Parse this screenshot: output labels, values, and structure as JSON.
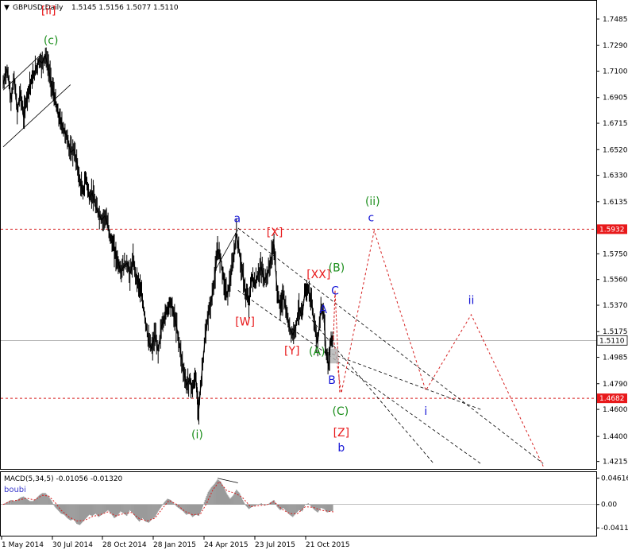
{
  "header": {
    "symbol_label": "GBPUSD,Daily",
    "ohlc": "1.5145 1.5156 1.5077 1.5110"
  },
  "colors": {
    "price": "#000000",
    "red": "#e8191b",
    "blue": "#1717d6",
    "green": "#1d8f1d",
    "dashed_red": "#d62020",
    "current_price_bg": "#ffffff",
    "level_bg": "#e8191b",
    "grid_line": "#888888"
  },
  "chart_data": [
    {
      "type": "line",
      "title": "GBPUSD,Daily",
      "subtitle": "1.5145 1.5156 1.5077 1.5110",
      "x_ticks": [
        "1 May 2014",
        "30 Jul 2014",
        "28 Oct 2014",
        "28 Jan 2015",
        "24 Apr 2015",
        "23 Jul 2015",
        "21 Oct 2015"
      ],
      "y_ticks": [
        "1.7485",
        "1.7290",
        "1.7100",
        "1.6905",
        "1.6715",
        "1.6520",
        "1.6330",
        "1.6135",
        "1.5945",
        "1.5750",
        "1.5560",
        "1.5370",
        "1.5175",
        "1.4985",
        "1.4790",
        "1.4600",
        "1.4400",
        "1.4215"
      ],
      "ylim": [
        1.416,
        1.762
      ],
      "current_price": "1.5110",
      "levels": [
        {
          "label": "1.5932",
          "value": 1.5932
        },
        {
          "label": "1.4682",
          "value": 1.4682
        }
      ],
      "price_series": [
        [
          0,
          1.7
        ],
        [
          5,
          1.712
        ],
        [
          10,
          1.689
        ],
        [
          14,
          1.705
        ],
        [
          18,
          1.68
        ],
        [
          22,
          1.695
        ],
        [
          26,
          1.676
        ],
        [
          30,
          1.69
        ],
        [
          34,
          1.7
        ],
        [
          38,
          1.705
        ],
        [
          42,
          1.712
        ],
        [
          46,
          1.718
        ],
        [
          50,
          1.716
        ],
        [
          54,
          1.722
        ],
        [
          58,
          1.712
        ],
        [
          62,
          1.7
        ],
        [
          66,
          1.69
        ],
        [
          70,
          1.678
        ],
        [
          74,
          1.672
        ],
        [
          78,
          1.666
        ],
        [
          82,
          1.66
        ],
        [
          86,
          1.65
        ],
        [
          90,
          1.652
        ],
        [
          94,
          1.643
        ],
        [
          98,
          1.628
        ],
        [
          102,
          1.62
        ],
        [
          106,
          1.632
        ],
        [
          110,
          1.616
        ],
        [
          114,
          1.62
        ],
        [
          118,
          1.61
        ],
        [
          122,
          1.605
        ],
        [
          126,
          1.6
        ],
        [
          130,
          1.603
        ],
        [
          134,
          1.596
        ],
        [
          138,
          1.585
        ],
        [
          142,
          1.578
        ],
        [
          146,
          1.57
        ],
        [
          150,
          1.562
        ],
        [
          154,
          1.566
        ],
        [
          158,
          1.568
        ],
        [
          162,
          1.56
        ],
        [
          166,
          1.57
        ],
        [
          170,
          1.558
        ],
        [
          174,
          1.552
        ],
        [
          178,
          1.54
        ],
        [
          182,
          1.525
        ],
        [
          186,
          1.51
        ],
        [
          190,
          1.505
        ],
        [
          194,
          1.515
        ],
        [
          198,
          1.503
        ],
        [
          202,
          1.52
        ],
        [
          206,
          1.528
        ],
        [
          210,
          1.535
        ],
        [
          214,
          1.54
        ],
        [
          218,
          1.53
        ],
        [
          222,
          1.52
        ],
        [
          226,
          1.505
        ],
        [
          230,
          1.49
        ],
        [
          234,
          1.478
        ],
        [
          238,
          1.482
        ],
        [
          242,
          1.475
        ],
        [
          246,
          1.485
        ],
        [
          248,
          1.468
        ],
        [
          250,
          1.46
        ],
        [
          254,
          1.488
        ],
        [
          258,
          1.512
        ],
        [
          262,
          1.53
        ],
        [
          266,
          1.54
        ],
        [
          270,
          1.556
        ],
        [
          274,
          1.578
        ],
        [
          278,
          1.572
        ],
        [
          282,
          1.555
        ],
        [
          286,
          1.545
        ],
        [
          290,
          1.555
        ],
        [
          294,
          1.57
        ],
        [
          298,
          1.59
        ],
        [
          302,
          1.575
        ],
        [
          306,
          1.56
        ],
        [
          310,
          1.545
        ],
        [
          314,
          1.54
        ],
        [
          318,
          1.558
        ],
        [
          322,
          1.552
        ],
        [
          326,
          1.56
        ],
        [
          330,
          1.565
        ],
        [
          334,
          1.555
        ],
        [
          338,
          1.56
        ],
        [
          342,
          1.57
        ],
        [
          346,
          1.582
        ],
        [
          350,
          1.548
        ],
        [
          354,
          1.535
        ],
        [
          358,
          1.545
        ],
        [
          362,
          1.53
        ],
        [
          366,
          1.52
        ],
        [
          370,
          1.515
        ],
        [
          374,
          1.522
        ],
        [
          378,
          1.535
        ],
        [
          382,
          1.528
        ],
        [
          386,
          1.55
        ],
        [
          390,
          1.548
        ],
        [
          394,
          1.54
        ],
        [
          398,
          1.52
        ],
        [
          402,
          1.51
        ],
        [
          406,
          1.535
        ],
        [
          410,
          1.53
        ],
        [
          412,
          1.505
        ],
        [
          416,
          1.492
        ],
        [
          418,
          1.51
        ],
        [
          422,
          1.511
        ]
      ],
      "macd_panel": {
        "title": "MACD(5,34,5) -0.01056 -0.01320",
        "subtitle": "boubi",
        "y_ticks": [
          "0.04616",
          "0.00",
          "-0.04114"
        ],
        "ylim": [
          -0.052,
          0.054
        ],
        "histogram": [
          [
            0,
            0.0
          ],
          [
            5,
            0.004
          ],
          [
            10,
            0.008
          ],
          [
            14,
            0.006
          ],
          [
            18,
            0.008
          ],
          [
            22,
            0.012
          ],
          [
            26,
            0.014
          ],
          [
            30,
            0.01
          ],
          [
            34,
            0.006
          ],
          [
            38,
            0.006
          ],
          [
            42,
            0.01
          ],
          [
            46,
            0.016
          ],
          [
            50,
            0.02
          ],
          [
            54,
            0.02
          ],
          [
            58,
            0.014
          ],
          [
            62,
            0.006
          ],
          [
            66,
            -0.004
          ],
          [
            70,
            -0.01
          ],
          [
            74,
            -0.016
          ],
          [
            78,
            -0.018
          ],
          [
            82,
            -0.024
          ],
          [
            86,
            -0.028
          ],
          [
            90,
            -0.026
          ],
          [
            94,
            -0.034
          ],
          [
            98,
            -0.036
          ],
          [
            102,
            -0.03
          ],
          [
            106,
            -0.024
          ],
          [
            110,
            -0.018
          ],
          [
            114,
            -0.02
          ],
          [
            118,
            -0.016
          ],
          [
            122,
            -0.022
          ],
          [
            126,
            -0.018
          ],
          [
            130,
            -0.014
          ],
          [
            134,
            -0.01
          ],
          [
            138,
            -0.016
          ],
          [
            142,
            -0.024
          ],
          [
            146,
            -0.02
          ],
          [
            150,
            -0.012
          ],
          [
            154,
            -0.016
          ],
          [
            158,
            -0.02
          ],
          [
            162,
            -0.01
          ],
          [
            166,
            -0.016
          ],
          [
            170,
            -0.024
          ],
          [
            174,
            -0.03
          ],
          [
            178,
            -0.024
          ],
          [
            182,
            -0.03
          ],
          [
            186,
            -0.032
          ],
          [
            190,
            -0.026
          ],
          [
            194,
            -0.022
          ],
          [
            198,
            -0.012
          ],
          [
            202,
            -0.004
          ],
          [
            206,
            0.004
          ],
          [
            210,
            0.01
          ],
          [
            214,
            0.008
          ],
          [
            218,
            0.002
          ],
          [
            222,
            -0.004
          ],
          [
            226,
            -0.008
          ],
          [
            230,
            -0.012
          ],
          [
            234,
            -0.018
          ],
          [
            238,
            -0.016
          ],
          [
            242,
            -0.022
          ],
          [
            246,
            -0.018
          ],
          [
            250,
            -0.02
          ],
          [
            254,
            -0.008
          ],
          [
            258,
            0.008
          ],
          [
            262,
            0.022
          ],
          [
            266,
            0.03
          ],
          [
            270,
            0.036
          ],
          [
            274,
            0.044
          ],
          [
            278,
            0.04
          ],
          [
            282,
            0.03
          ],
          [
            286,
            0.018
          ],
          [
            290,
            0.01
          ],
          [
            294,
            0.016
          ],
          [
            298,
            0.026
          ],
          [
            302,
            0.02
          ],
          [
            306,
            0.008
          ],
          [
            310,
            -0.002
          ],
          [
            314,
            -0.008
          ],
          [
            318,
            -0.004
          ],
          [
            322,
            -0.002
          ],
          [
            326,
            0.0
          ],
          [
            330,
            0.002
          ],
          [
            334,
            -0.002
          ],
          [
            338,
            0.0
          ],
          [
            342,
            0.004
          ],
          [
            346,
            0.008
          ],
          [
            350,
            -0.004
          ],
          [
            354,
            -0.01
          ],
          [
            358,
            -0.006
          ],
          [
            362,
            -0.012
          ],
          [
            366,
            -0.018
          ],
          [
            370,
            -0.022
          ],
          [
            374,
            -0.016
          ],
          [
            378,
            -0.01
          ],
          [
            382,
            -0.012
          ],
          [
            386,
            0.0
          ],
          [
            390,
            0.002
          ],
          [
            394,
            -0.004
          ],
          [
            398,
            -0.01
          ],
          [
            402,
            -0.014
          ],
          [
            406,
            -0.006
          ],
          [
            410,
            -0.008
          ],
          [
            414,
            -0.014
          ],
          [
            418,
            -0.012
          ],
          [
            422,
            -0.011
          ]
        ],
        "signal": [
          [
            0,
            0.0
          ],
          [
            10,
            0.006
          ],
          [
            20,
            0.008
          ],
          [
            30,
            0.011
          ],
          [
            40,
            0.008
          ],
          [
            50,
            0.016
          ],
          [
            58,
            0.015
          ],
          [
            66,
            0.004
          ],
          [
            74,
            -0.01
          ],
          [
            84,
            -0.022
          ],
          [
            94,
            -0.029
          ],
          [
            104,
            -0.028
          ],
          [
            114,
            -0.021
          ],
          [
            124,
            -0.018
          ],
          [
            134,
            -0.013
          ],
          [
            144,
            -0.02
          ],
          [
            154,
            -0.016
          ],
          [
            164,
            -0.014
          ],
          [
            174,
            -0.025
          ],
          [
            184,
            -0.029
          ],
          [
            194,
            -0.024
          ],
          [
            204,
            -0.006
          ],
          [
            212,
            0.007
          ],
          [
            222,
            0.0
          ],
          [
            232,
            -0.012
          ],
          [
            242,
            -0.018
          ],
          [
            252,
            -0.017
          ],
          [
            260,
            0.002
          ],
          [
            268,
            0.026
          ],
          [
            276,
            0.04
          ],
          [
            286,
            0.024
          ],
          [
            296,
            0.02
          ],
          [
            306,
            0.012
          ],
          [
            316,
            -0.004
          ],
          [
            326,
            -0.002
          ],
          [
            338,
            0.0
          ],
          [
            346,
            0.005
          ],
          [
            356,
            -0.008
          ],
          [
            366,
            -0.016
          ],
          [
            376,
            -0.016
          ],
          [
            386,
            -0.004
          ],
          [
            396,
            -0.005
          ],
          [
            406,
            -0.01
          ],
          [
            416,
            -0.012
          ],
          [
            422,
            -0.013
          ]
        ]
      }
    }
  ],
  "wave_labels": [
    {
      "text": "[ii]",
      "color": "red",
      "xi": 58,
      "y": 1.752
    },
    {
      "text": "(c)",
      "color": "green",
      "xi": 61,
      "y": 1.73
    },
    {
      "text": "a",
      "color": "blue",
      "xi": 299,
      "y": 1.5985
    },
    {
      "text": "(ii)",
      "color": "green",
      "xi": 472,
      "y": 1.611
    },
    {
      "text": "c",
      "color": "blue",
      "xi": 470,
      "y": 1.599
    },
    {
      "text": "[X]",
      "color": "red",
      "xi": 347,
      "y": 1.588
    },
    {
      "text": "[XX]",
      "color": "red",
      "xi": 403,
      "y": 1.557
    },
    {
      "text": "(B)",
      "color": "green",
      "xi": 426,
      "y": 1.562
    },
    {
      "text": "C",
      "color": "blue",
      "xi": 424,
      "y": 1.545
    },
    {
      "text": "A",
      "color": "blue",
      "xi": 409,
      "y": 1.531
    },
    {
      "text": "[W]",
      "color": "red",
      "xi": 309,
      "y": 1.522
    },
    {
      "text": "[Y]",
      "color": "red",
      "xi": 369,
      "y": 1.5005
    },
    {
      "text": "(A)",
      "color": "green",
      "xi": 401,
      "y": 1.5
    },
    {
      "text": "B",
      "color": "blue",
      "xi": 420,
      "y": 1.479
    },
    {
      "text": "ii",
      "color": "blue",
      "xi": 598,
      "y": 1.538
    },
    {
      "text": "i",
      "color": "blue",
      "xi": 540,
      "y": 1.456
    },
    {
      "text": "(C)",
      "color": "green",
      "xi": 431,
      "y": 1.456
    },
    {
      "text": "[Z]",
      "color": "red",
      "xi": 432,
      "y": 1.44
    },
    {
      "text": "b",
      "color": "blue",
      "xi": 432,
      "y": 1.429
    },
    {
      "text": "(i)",
      "color": "green",
      "xi": 248,
      "y": 1.4385
    }
  ],
  "projection_path": [
    [
      422,
      1.513
    ],
    [
      432,
      1.472
    ],
    [
      474,
      1.592
    ],
    [
      540,
      1.474
    ],
    [
      598,
      1.53
    ],
    [
      690,
      1.418
    ]
  ],
  "red_short_path": [
    [
      422,
      1.513
    ],
    [
      424,
      1.548
    ],
    [
      430,
      1.472
    ]
  ],
  "channels": [
    [
      [
        300,
        1.594
      ],
      [
        690,
        1.42
      ]
    ],
    [
      [
        300,
        1.548
      ],
      [
        610,
        1.42
      ]
    ],
    [
      [
        390,
        1.529
      ],
      [
        550,
        1.42
      ]
    ],
    [
      [
        420,
        1.501
      ],
      [
        610,
        1.46
      ]
    ]
  ],
  "upper_channel": [
    [
      [
        0,
        1.696
      ],
      [
        48,
        1.722
      ]
    ],
    [
      [
        0,
        1.654
      ],
      [
        86,
        1.7
      ]
    ]
  ],
  "macd_lines": [
    [
      [
        274,
        0.046
      ],
      [
        300,
        0.038
      ]
    ]
  ],
  "upper_a_line": [
    [
      [
        270,
        1.562
      ],
      [
        300,
        1.593
      ]
    ]
  ]
}
